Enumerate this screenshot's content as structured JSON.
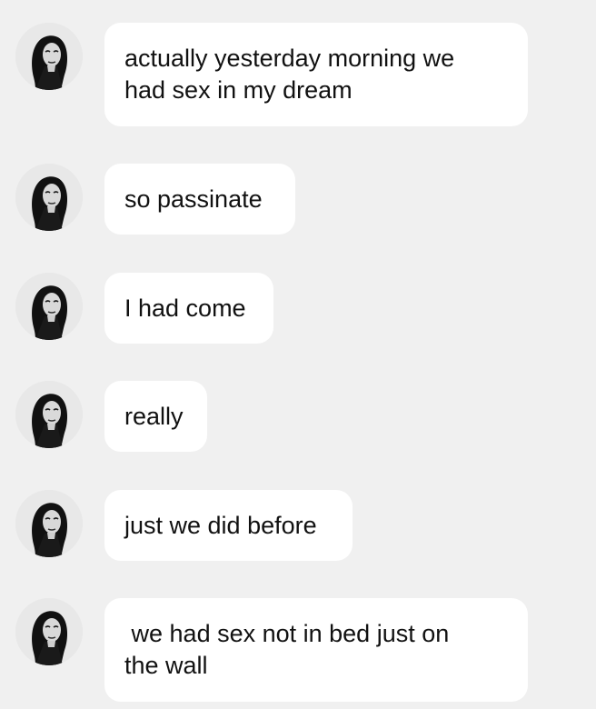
{
  "conversation": {
    "sender_avatar": "woman-portrait-avatar",
    "messages": [
      {
        "text": "actually yesterday morning we\nhad sex in my dream"
      },
      {
        "text": "so passinate"
      },
      {
        "text": "I had come"
      },
      {
        "text": "really"
      },
      {
        "text": "just we did before"
      },
      {
        "text": " we had sex not in bed just on\nthe wall"
      }
    ]
  },
  "colors": {
    "background": "#f0f0f0",
    "bubble": "#ffffff",
    "text": "#111111"
  }
}
